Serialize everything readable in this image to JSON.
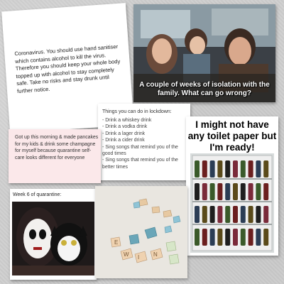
{
  "sanitiser_note": {
    "text": "Coronavirus. You should use hand sanitiser which contains alcohol to kill the virus. Therefore you should keep your whole body topped up with alcohol to stay completely safe. Take no risks and stay drunk until further notice."
  },
  "movie_meme": {
    "caption": "A couple of weeks of isolation with the family. What can go wrong?"
  },
  "lockdown_list": {
    "title": "Things you can do in lockdown:",
    "items": [
      "- Drink a whiskey drink",
      "- Drink a vodka drink",
      "- Drink a lager drink",
      "- Drink a cider drink",
      "- Sing songs that remind you of the good times",
      "- Sing songs that remind you of the better times"
    ]
  },
  "pancakes_note": {
    "text": "Got up this morning & made pancakes for my kids & drink some champagne for myself because quarantine self-care looks different for everyone"
  },
  "fridge_meme": {
    "caption": "I might not have any toilet paper but I'm ready!"
  },
  "week6_meme": {
    "label": "Week 6 of quarantine:"
  },
  "wine_letters": {
    "letters": [
      "W",
      "I",
      "N",
      "E"
    ]
  },
  "colors": {
    "background": "#cfcfcf",
    "pink_card": "#fbe8ea",
    "caption_text": "#ffffff"
  }
}
